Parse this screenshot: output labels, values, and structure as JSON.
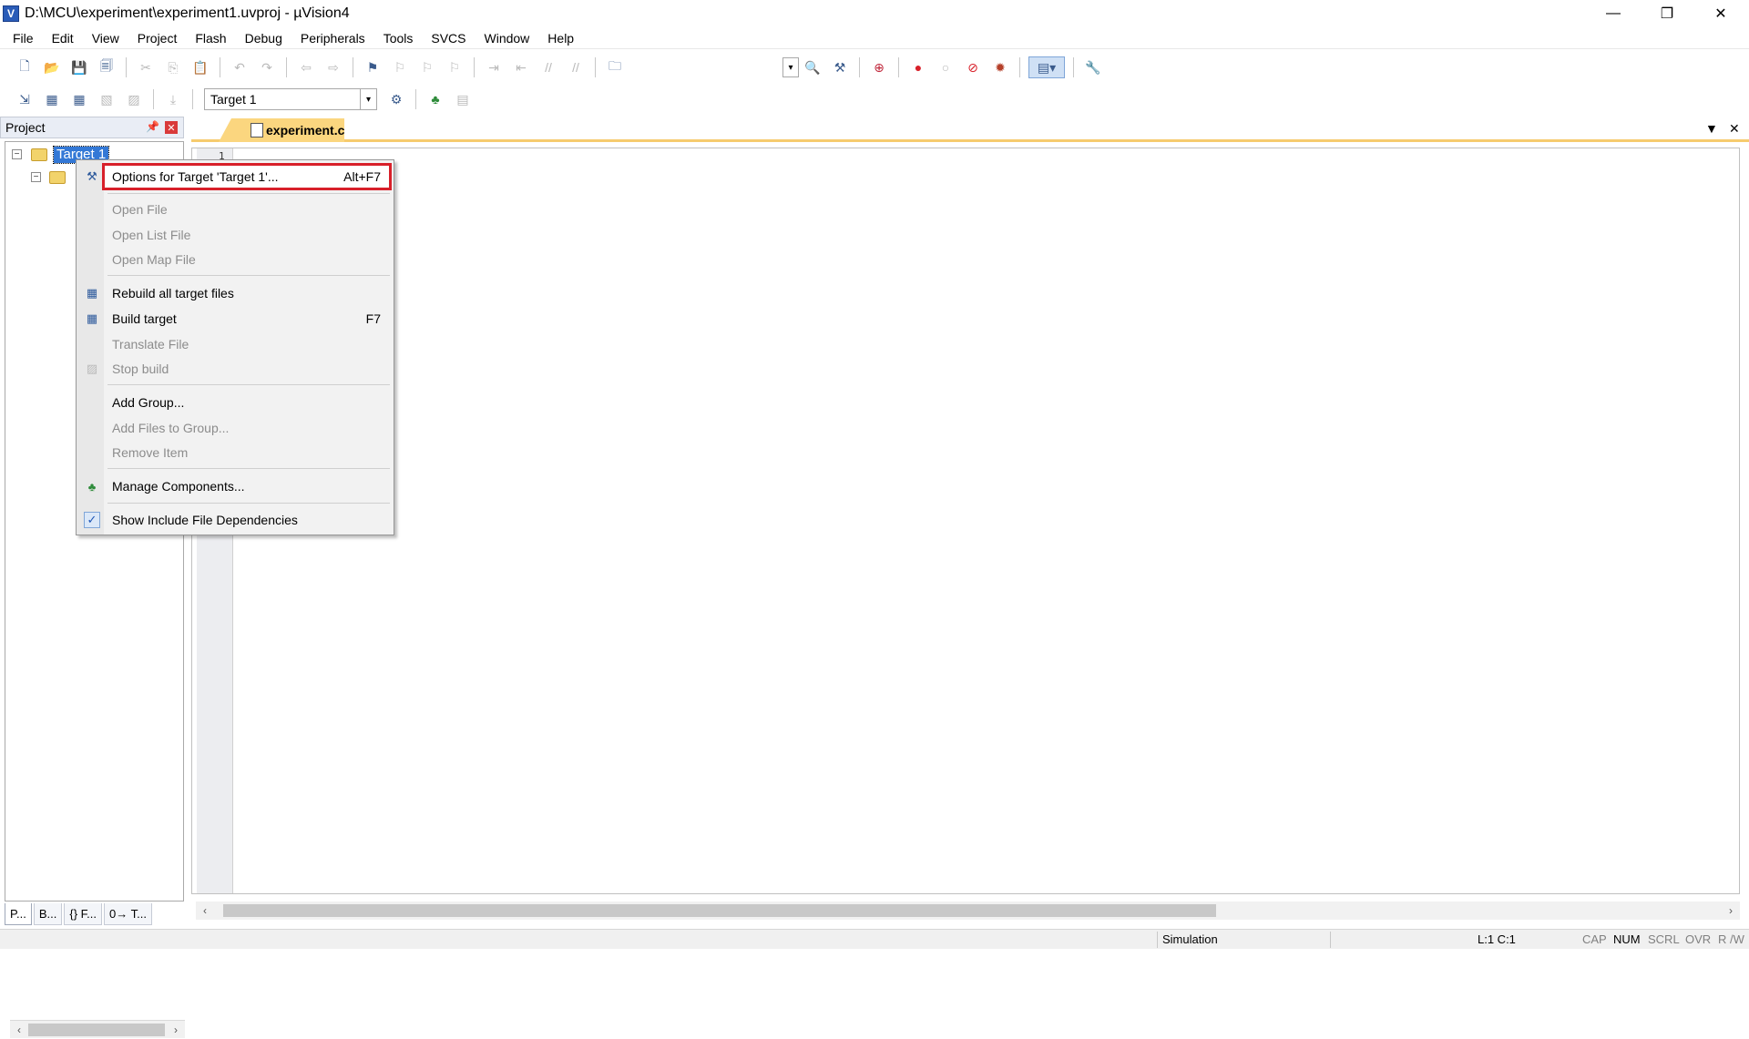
{
  "window": {
    "title": "D:\\MCU\\experiment\\experiment1.uvproj - µVision4",
    "icon_letter": "V",
    "controls": {
      "minimize": "—",
      "restore": "❐",
      "close": "✕"
    }
  },
  "menu": [
    "File",
    "Edit",
    "View",
    "Project",
    "Flash",
    "Debug",
    "Peripherals",
    "Tools",
    "SVCS",
    "Window",
    "Help"
  ],
  "toolbar2": {
    "target_select": "Target 1"
  },
  "project_pane": {
    "title": "Project",
    "tree_root": "Target 1",
    "bottom_tabs": [
      "P...",
      "B...",
      "{} F...",
      "0→ T..."
    ]
  },
  "editor": {
    "tab_label": "experiment.c",
    "line_number": "1"
  },
  "context_menu": {
    "items": [
      {
        "label": "Options for Target 'Target 1'...",
        "shortcut": "Alt+F7",
        "icon": "options-wand-icon",
        "disabled": false
      },
      {
        "label": "Open File",
        "disabled": true
      },
      {
        "label": "Open List File",
        "disabled": true
      },
      {
        "label": "Open Map File",
        "disabled": false
      },
      {
        "label": "Rebuild all target files",
        "icon": "rebuild-icon",
        "disabled": false
      },
      {
        "label": "Build target",
        "shortcut": "F7",
        "icon": "build-icon",
        "disabled": false
      },
      {
        "label": "Translate File",
        "disabled": true
      },
      {
        "label": "Stop build",
        "icon": "stop-build-icon",
        "disabled": true
      },
      {
        "label": "Add Group...",
        "disabled": false
      },
      {
        "label": "Add Files to Group...",
        "disabled": true
      },
      {
        "label": "Remove Item",
        "disabled": true
      },
      {
        "label": "Manage Components...",
        "icon": "components-icon",
        "disabled": false
      },
      {
        "label": "Show Include File Dependencies",
        "icon": "check-icon",
        "disabled": false
      }
    ]
  },
  "status_bar": {
    "mode": "Simulation",
    "position": "L:1 C:1",
    "cap": "CAP",
    "num": "NUM",
    "scrl": "SCRL",
    "ovr": "OVR",
    "rw": "R /W"
  },
  "colors": {
    "highlight_border": "#d8202a",
    "selection": "#3378d6",
    "tab_active": "#fbd67f"
  }
}
